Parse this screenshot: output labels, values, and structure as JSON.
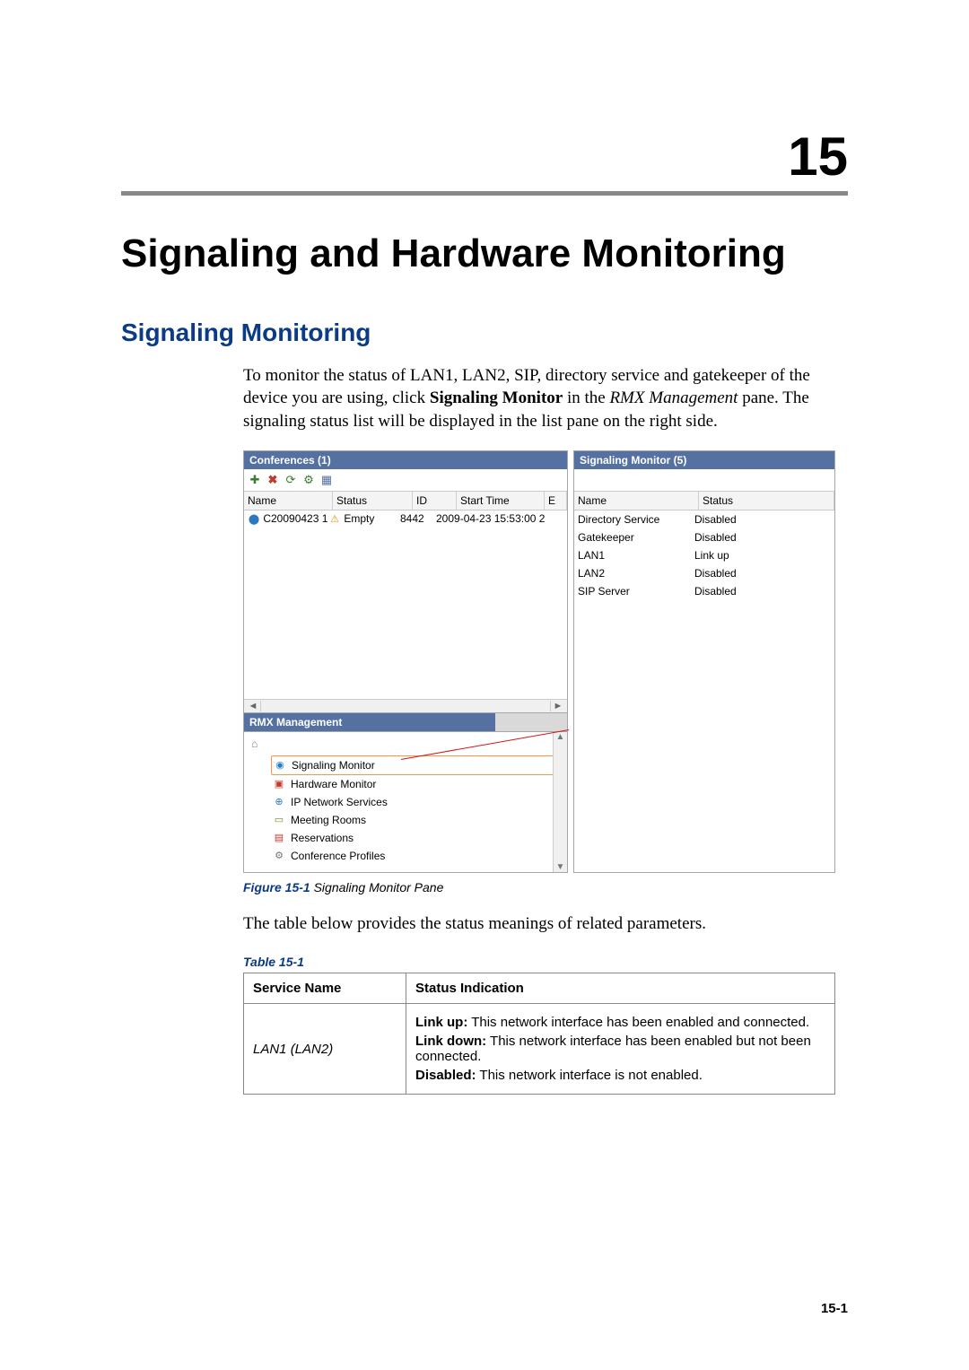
{
  "chapter": {
    "number": "15",
    "title": "Signaling and Hardware Monitoring"
  },
  "section": {
    "title": "Signaling Monitoring",
    "intro_pre": "To monitor the status of LAN1, LAN2, SIP, directory service and gatekeeper of the device you are using, click ",
    "intro_bold": "Signaling Monitor",
    "intro_mid": " in the ",
    "intro_italic": "RMX Management",
    "intro_post": " pane. The signaling status list will be displayed in the list pane on the right side."
  },
  "figure": {
    "label": "Figure 15-1",
    "text": "Signaling Monitor Pane",
    "left_pane": {
      "title": "Conferences (1)",
      "columns": [
        "Name",
        "Status",
        "ID",
        "Start Time",
        "E"
      ],
      "row": {
        "name": "C20090423 1",
        "status": "Empty",
        "id": "8442",
        "start": "2009-04-23 15:53:00 2"
      },
      "rmx_title": "RMX Management",
      "rmx_items": [
        {
          "label": "Signaling Monitor",
          "selected": true
        },
        {
          "label": "Hardware Monitor",
          "selected": false
        },
        {
          "label": "IP Network Services",
          "selected": false
        },
        {
          "label": "Meeting Rooms",
          "selected": false
        },
        {
          "label": "Reservations",
          "selected": false
        },
        {
          "label": "Conference Profiles",
          "selected": false
        }
      ]
    },
    "right_pane": {
      "title": "Signaling Monitor (5)",
      "columns": [
        "Name",
        "Status"
      ],
      "rows": [
        {
          "name": "Directory Service",
          "status": "Disabled"
        },
        {
          "name": "Gatekeeper",
          "status": "Disabled"
        },
        {
          "name": "LAN1",
          "status": "Link up"
        },
        {
          "name": "LAN2",
          "status": "Disabled"
        },
        {
          "name": "SIP Server",
          "status": "Disabled"
        }
      ]
    }
  },
  "after_figure": "The table below provides the status meanings of related parameters.",
  "table": {
    "caption": "Table 15-1",
    "headers": [
      "Service Name",
      "Status Indication"
    ],
    "row1_service": "LAN1 (LAN2)",
    "row1_lines": [
      {
        "bold": "Link up:",
        "rest": " This network interface has been enabled and connected."
      },
      {
        "bold": "Link down:",
        "rest": " This network interface has been enabled but not been connected."
      },
      {
        "bold": "Disabled:",
        "rest": " This network interface is not enabled."
      }
    ]
  },
  "page_number": "15-1"
}
